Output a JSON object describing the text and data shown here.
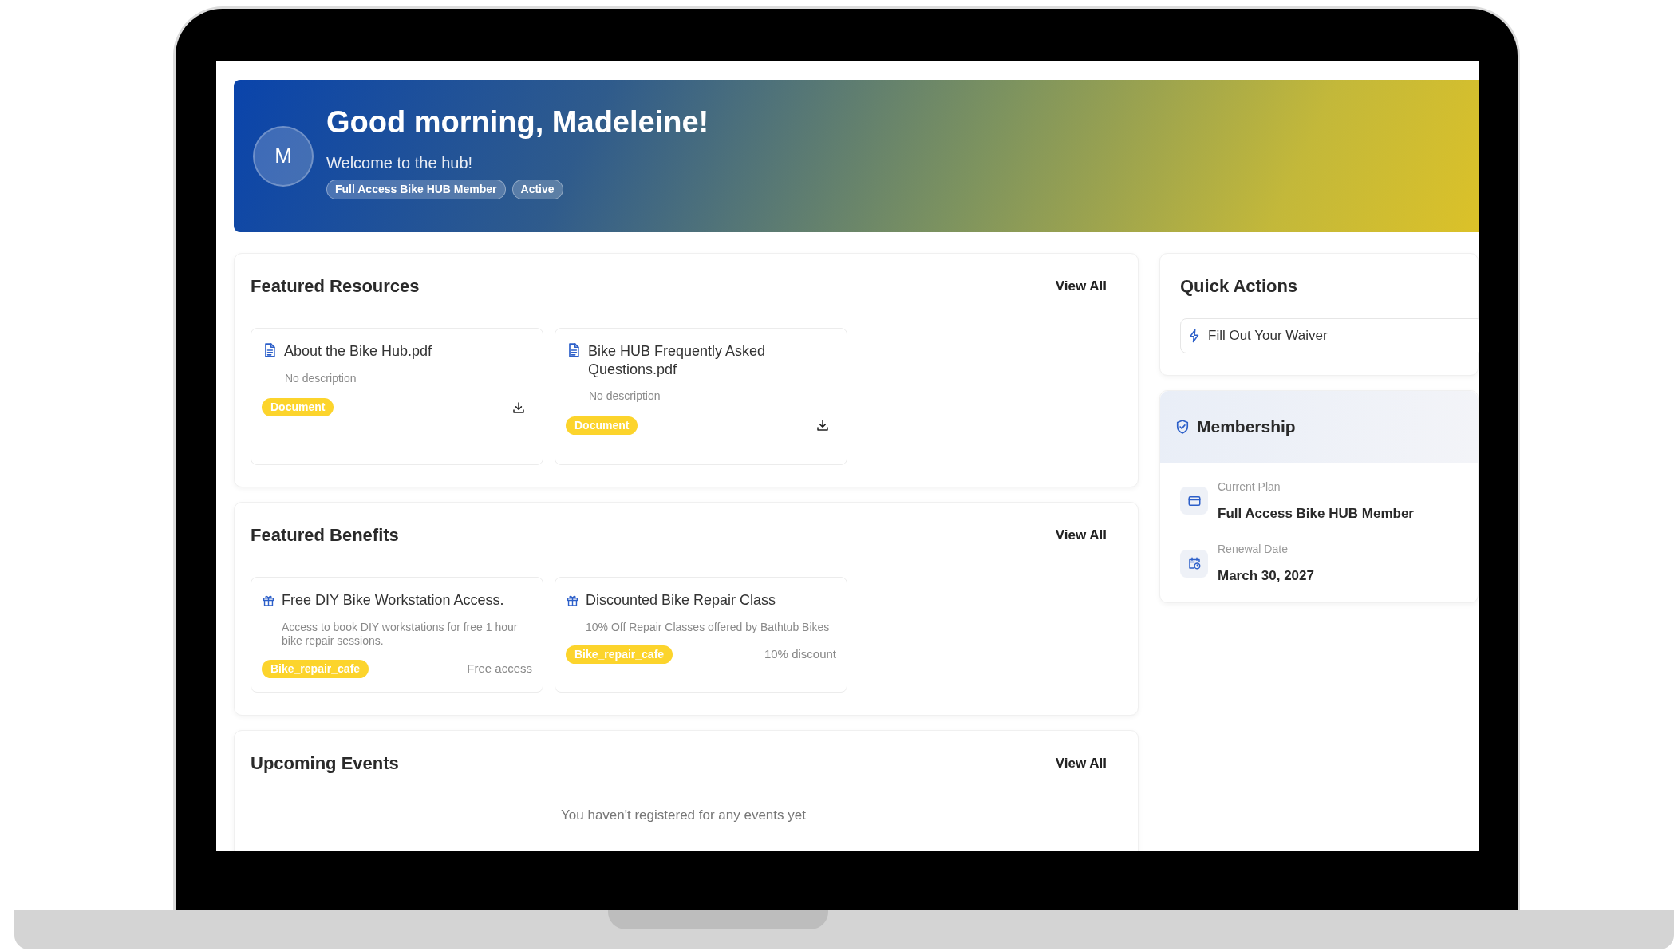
{
  "greeting": {
    "avatar_initial": "M",
    "title": "Good morning, Madeleine!",
    "subtitle": "Welcome to the hub!",
    "tags": [
      "Full Access Bike HUB Member",
      "Active"
    ]
  },
  "featured_resources": {
    "title": "Featured Resources",
    "view_all": "View All",
    "items": [
      {
        "title": "About the Bike Hub.pdf",
        "description": "No description",
        "tag": "Document"
      },
      {
        "title": "Bike HUB Frequently Asked Questions.pdf",
        "description": "No description",
        "tag": "Document"
      }
    ]
  },
  "featured_benefits": {
    "title": "Featured Benefits",
    "view_all": "View All",
    "items": [
      {
        "title": "Free DIY Bike Workstation Access.",
        "description": "Access to book DIY workstations for free 1 hour bike repair sessions.",
        "tag": "Bike_repair_cafe",
        "value": "Free access"
      },
      {
        "title": "Discounted Bike Repair Class",
        "description": "10% Off Repair Classes offered by Bathtub Bikes",
        "tag": "Bike_repair_cafe",
        "value": "10% discount"
      }
    ]
  },
  "upcoming_events": {
    "title": "Upcoming Events",
    "view_all": "View All",
    "empty_message": "You haven't registered for any events yet"
  },
  "quick_actions": {
    "title": "Quick Actions",
    "actions": [
      "Fill Out Your Waiver"
    ]
  },
  "membership": {
    "title": "Membership",
    "fields": [
      {
        "kind": "plan",
        "label": "Current Plan",
        "value": "Full Access Bike HUB Member"
      },
      {
        "kind": "date",
        "label": "Renewal Date",
        "value": "March 30, 2027"
      }
    ]
  }
}
